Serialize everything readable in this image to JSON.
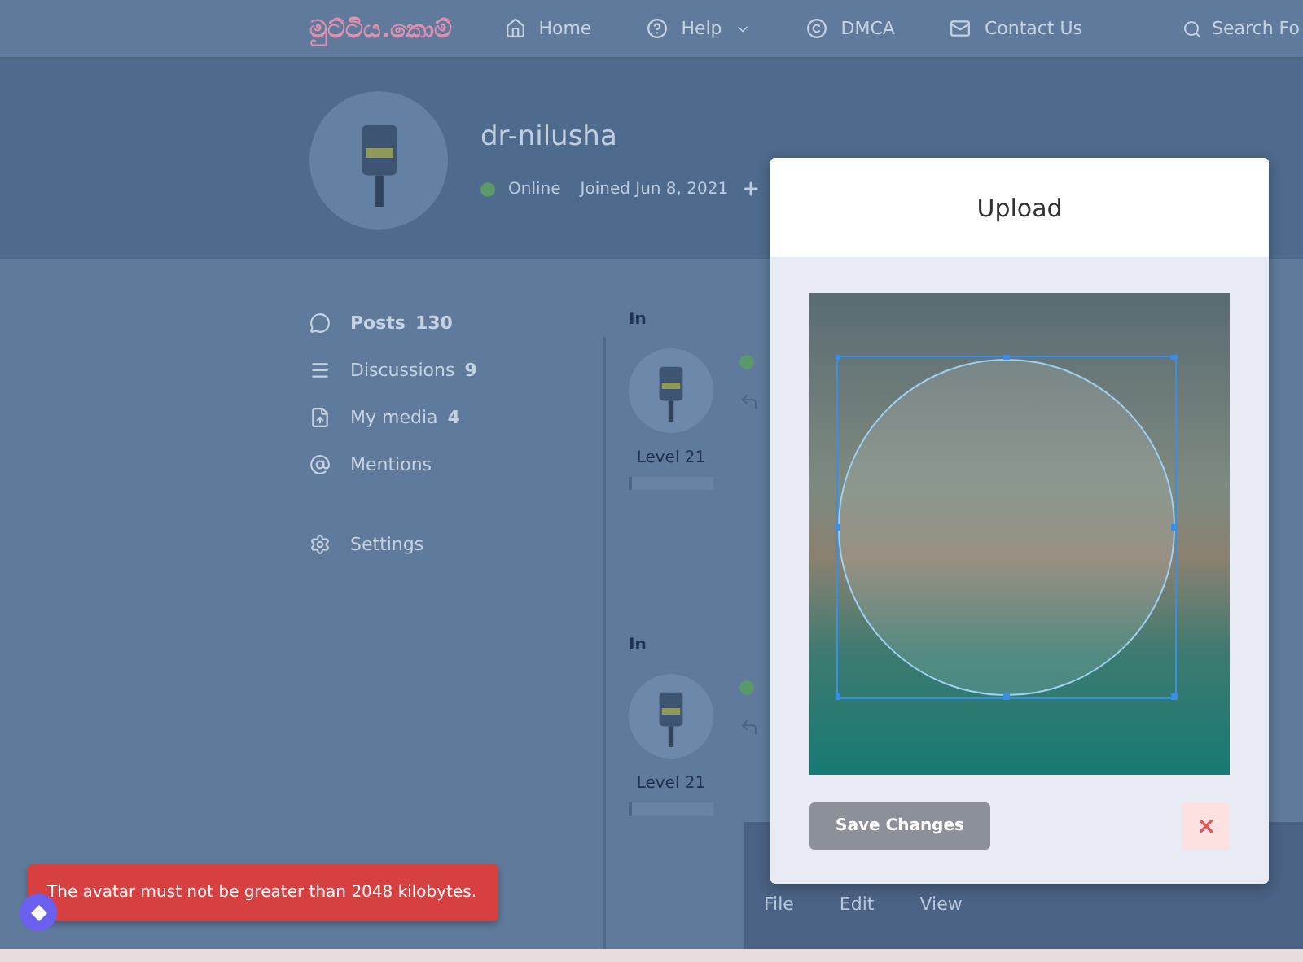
{
  "nav": {
    "logo": "මුට්ටිය.කොම්",
    "items": [
      {
        "kind": "home",
        "label": "Home",
        "dropdown": false
      },
      {
        "kind": "help",
        "label": "Help",
        "dropdown": true
      },
      {
        "kind": "copyright",
        "label": "DMCA",
        "dropdown": false
      },
      {
        "kind": "mail",
        "label": "Contact Us",
        "dropdown": false
      }
    ],
    "search": {
      "placeholder": "Search Fo"
    }
  },
  "profile": {
    "username": "dr-nilusha",
    "online": true,
    "status": "Online",
    "joined": "Joined Jun 8, 2021"
  },
  "sidebar": {
    "items": [
      {
        "kind": "posts",
        "label": "Posts",
        "count": "130",
        "selected": true
      },
      {
        "kind": "discussions",
        "label": "Discussions",
        "count": "9",
        "selected": false
      },
      {
        "kind": "media",
        "label": "My media",
        "count": "4",
        "selected": false
      },
      {
        "kind": "mentions",
        "label": "Mentions",
        "selected": false
      }
    ],
    "settings": "Settings"
  },
  "posts": [
    {
      "prefix": "In",
      "level": "Level 21",
      "online": true
    },
    {
      "prefix": "In",
      "level": "Level 21",
      "online": true
    }
  ],
  "editor_menu": [
    "File",
    "Edit",
    "View"
  ],
  "modal": {
    "title": "Upload",
    "save": "Save Changes"
  },
  "toast": {
    "message": "The avatar must not be greater than 2048 kilobytes."
  }
}
